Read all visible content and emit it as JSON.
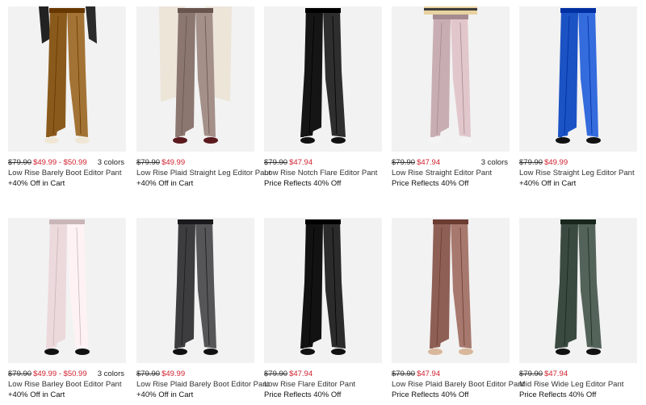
{
  "products": [
    {
      "orig": "$79.90",
      "sale": "$49.99 - $50.99",
      "colors": "3 colors",
      "name": "Low Rise Barely Boot Editor Pant",
      "promo": "+40% Off in Cart",
      "pant_color": "#8a5a1c",
      "variant": "boot-blazer"
    },
    {
      "orig": "$79.90",
      "sale": "$49.99",
      "colors": "",
      "name": "Low Rise Plaid Straight Leg Editor Pant",
      "promo": "+40% Off in Cart",
      "pant_color": "#8b7770",
      "variant": "straight-coat"
    },
    {
      "orig": "$79.90",
      "sale": "$47.94",
      "colors": "",
      "name": "Low Rise Notch Flare Editor Pant",
      "promo": "Price Reflects 40% Off",
      "pant_color": "#151515",
      "variant": "flare"
    },
    {
      "orig": "$79.90",
      "sale": "$47.94",
      "colors": "3 colors",
      "name": "Low Rise Straight Editor Pant",
      "promo": "Price Reflects 40% Off",
      "pant_color": "#c8aeb2",
      "variant": "straight-top"
    },
    {
      "orig": "$79.90",
      "sale": "$49.99",
      "colors": "",
      "name": "Low Rise Straight Leg Editor Pant",
      "promo": "+40% Off in Cart",
      "pant_color": "#1b52c4",
      "variant": "straight"
    },
    {
      "orig": "$79.90",
      "sale": "$49.99 - $50.99",
      "colors": "3 colors",
      "name": "Low Rise Barley Boot Editor Pant",
      "promo": "+40% Off in Cart",
      "pant_color": "#ecd9dc",
      "variant": "boot"
    },
    {
      "orig": "$79.90",
      "sale": "$49.99",
      "colors": "",
      "name": "Low Rise Plaid Barely Boot Editor Pant",
      "promo": "+40% Off in Cart",
      "pant_color": "#3d3d3f",
      "variant": "boot"
    },
    {
      "orig": "$79.90",
      "sale": "$47.94",
      "colors": "",
      "name": "Low Rise Flare Editor Pant",
      "promo": "Price Reflects 40% Off",
      "pant_color": "#121212",
      "variant": "flare"
    },
    {
      "orig": "$79.90",
      "sale": "$47.94",
      "colors": "",
      "name": "Low Rise Plaid Barely Boot Editor Pant",
      "promo": "Price Reflects 40% Off",
      "pant_color": "#8e5f55",
      "variant": "boot"
    },
    {
      "orig": "$79.90",
      "sale": "$47.94",
      "colors": "",
      "name": "Mid Rise Wide Leg Editor Pant",
      "promo": "Price Reflects 40% Off",
      "pant_color": "#3b4a40",
      "variant": "wide"
    }
  ]
}
